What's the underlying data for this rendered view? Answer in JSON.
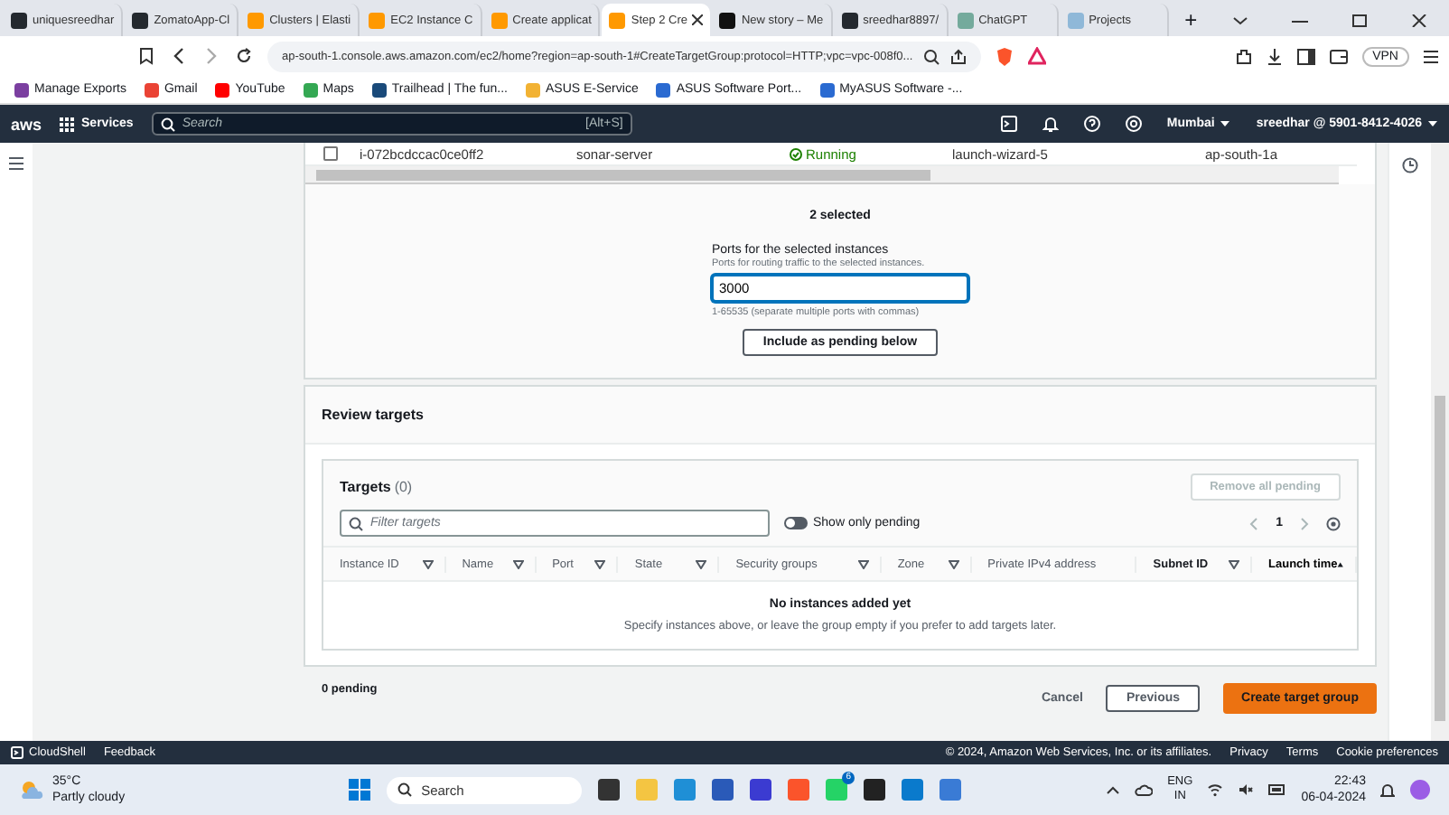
{
  "browser": {
    "tabs": [
      {
        "label": "uniquesreedhar",
        "selected": false
      },
      {
        "label": "ZomatoApp-Cl",
        "selected": false
      },
      {
        "label": "Clusters | Elasti",
        "selected": false
      },
      {
        "label": "EC2 Instance C",
        "selected": false
      },
      {
        "label": "Create applicat",
        "selected": false
      },
      {
        "label": "Step 2 Cre",
        "selected": true
      },
      {
        "label": "New story – Me",
        "selected": false
      },
      {
        "label": "sreedhar8897/",
        "selected": false
      },
      {
        "label": "ChatGPT",
        "selected": false
      },
      {
        "label": "Projects",
        "selected": false
      }
    ],
    "new_tab": "+",
    "url": "ap-south-1.console.aws.amazon.com/ec2/home?region=ap-south-1#CreateTargetGroup:protocol=HTTP;vpc=vpc-008f0...",
    "vpc_button": "VPN",
    "bookmarks": [
      "Manage Exports",
      "Gmail",
      "YouTube",
      "Maps",
      "Trailhead | The fun...",
      "ASUS E-Service",
      "ASUS Software Port...",
      "MyASUS Software -..."
    ]
  },
  "aws_nav": {
    "logo": "aws",
    "services": "Services",
    "search_placeholder": "Search",
    "search_shortcut": "[Alt+S]",
    "region": "Mumbai",
    "account": "sreedhar @ 5901-8412-4026"
  },
  "instance_row": {
    "checked": false,
    "cells": [
      "i-072bcdccac0ce0ff2",
      "sonar-server",
      "Running",
      "launch-wizard-5",
      "ap-south-1a"
    ]
  },
  "ports": {
    "selected_count": "2 selected",
    "label": "Ports for the selected instances",
    "description": "Ports for routing traffic to the selected instances.",
    "value": "3000",
    "hint": "1-65535 (separate multiple ports with commas)",
    "button": "Include as pending below"
  },
  "review": {
    "title": "Review targets",
    "targets_title": "Targets",
    "targets_count": "(0)",
    "remove_button": {
      "label": "Remove all pending",
      "disabled": true
    },
    "filter_placeholder": "Filter targets",
    "toggle": {
      "label": "Show only pending",
      "on": false
    },
    "page": "1",
    "columns": [
      {
        "label": "Instance ID",
        "sortable": true,
        "sorted": false,
        "bold": false
      },
      {
        "label": "Name",
        "sortable": true,
        "sorted": false,
        "bold": false
      },
      {
        "label": "Port",
        "sortable": true,
        "sorted": false,
        "bold": false
      },
      {
        "label": "State",
        "sortable": true,
        "sorted": false,
        "bold": false
      },
      {
        "label": "Security groups",
        "sortable": true,
        "sorted": false,
        "bold": false
      },
      {
        "label": "Zone",
        "sortable": true,
        "sorted": false,
        "bold": false
      },
      {
        "label": "Private IPv4 address",
        "sortable": false,
        "sorted": false,
        "bold": false
      },
      {
        "label": "Subnet ID",
        "sortable": true,
        "sorted": false,
        "bold": true
      },
      {
        "label": "Launch time",
        "sortable": true,
        "sorted": true,
        "bold": true
      }
    ],
    "empty_title": "No instances added yet",
    "empty_text": "Specify instances above, or leave the group empty if you prefer to add targets later."
  },
  "footer": {
    "pending": "0 pending",
    "cancel": "Cancel",
    "previous": "Previous",
    "create": "Create target group"
  },
  "aws_footer": {
    "left": [
      "CloudShell",
      "Feedback"
    ],
    "copyright": "© 2024, Amazon Web Services, Inc. or its affiliates.",
    "links": [
      "Privacy",
      "Terms",
      "Cookie preferences"
    ]
  },
  "taskbar": {
    "temperature": "35°C",
    "weather": "Partly cloudy",
    "search": "Search",
    "whatsapp_badge": "6",
    "lang": "ENG",
    "region": "IN",
    "time": "22:43",
    "date": "06-04-2024"
  }
}
